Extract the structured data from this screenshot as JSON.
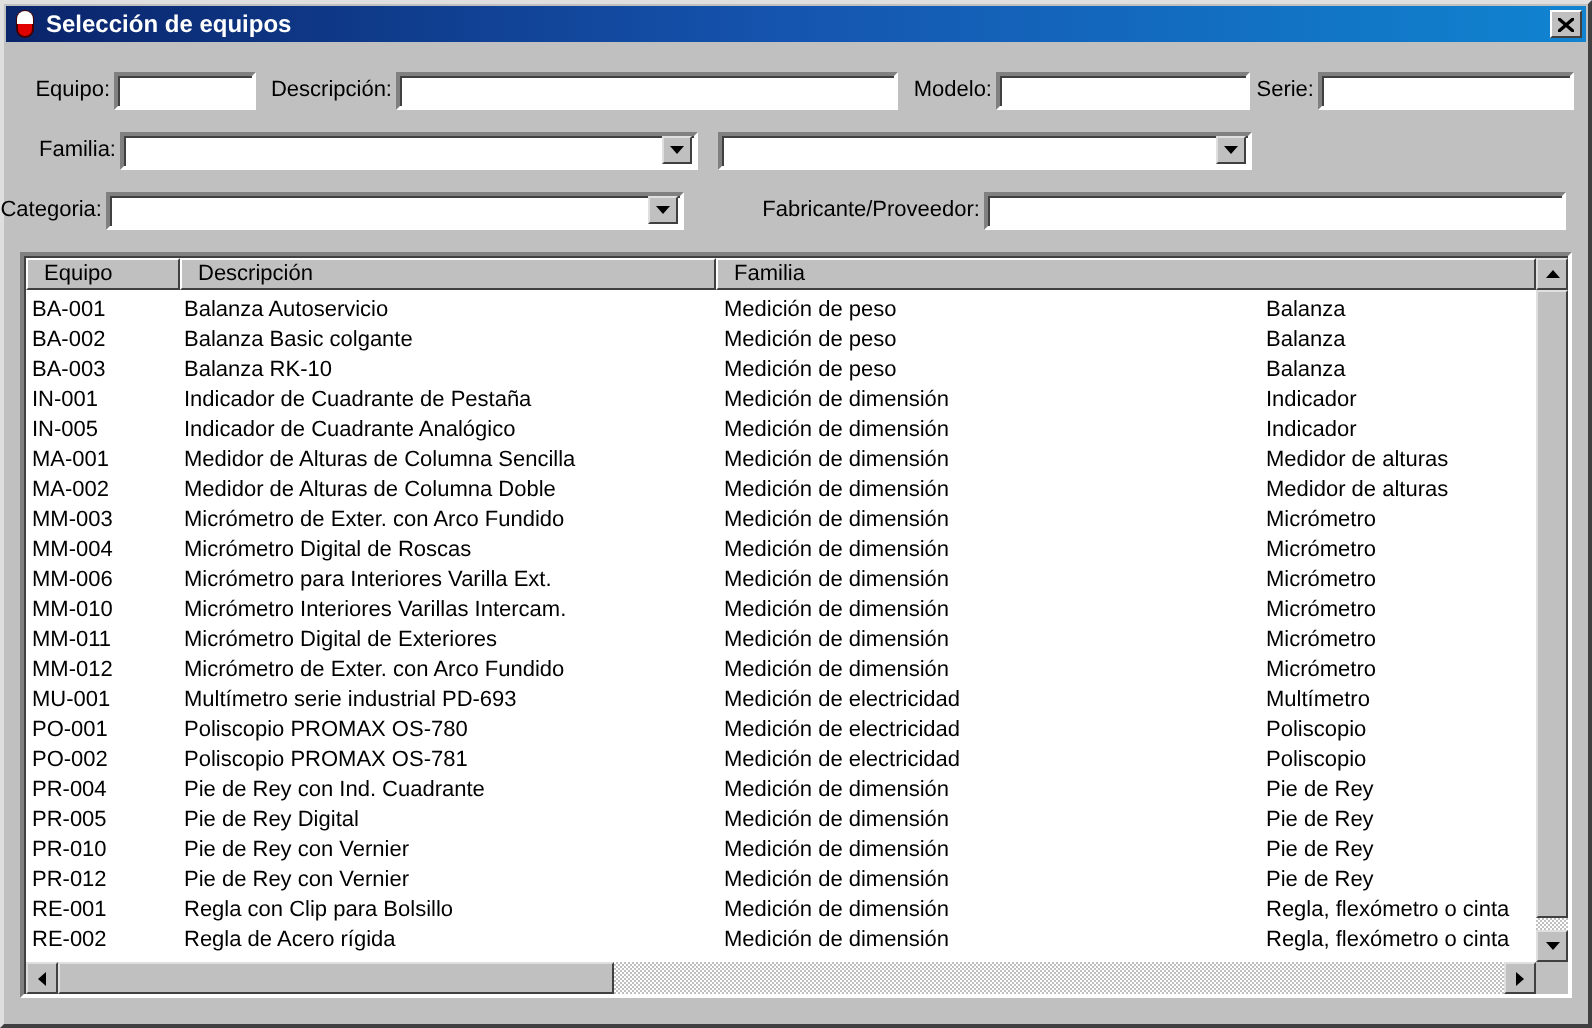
{
  "window": {
    "title": "Selección de equipos"
  },
  "form_rows": [
    {
      "fields": [
        {
          "kind": "text",
          "label": "Equipo:"
        },
        {
          "kind": "text",
          "label": "Descripción:"
        },
        {
          "kind": "text",
          "label": "Modelo:"
        },
        {
          "kind": "text",
          "label": "Serie:"
        }
      ]
    },
    {
      "fields": [
        {
          "kind": "dropdown",
          "label": "Familia:"
        },
        {
          "kind": "dropdown"
        }
      ]
    },
    {
      "fields": [
        {
          "kind": "dropdown",
          "label": "Categoria:"
        },
        {
          "kind": "text",
          "label": "Fabricante/Proveedor:"
        }
      ]
    }
  ],
  "table": {
    "columns": [
      "Equipo",
      "Descripción",
      "Familia"
    ],
    "rows": [
      {
        "cells": [
          "BA-001",
          "Balanza Autoservicio",
          "Medición de peso",
          "Balanza"
        ]
      },
      {
        "cells": [
          "BA-002",
          "Balanza Basic colgante",
          "Medición de peso",
          "Balanza"
        ]
      },
      {
        "cells": [
          "BA-003",
          "Balanza RK-10",
          "Medición de peso",
          "Balanza"
        ]
      },
      {
        "cells": [
          "IN-001",
          "Indicador de Cuadrante de Pestaña",
          "Medición de dimensión",
          "Indicador"
        ]
      },
      {
        "cells": [
          "IN-005",
          "Indicador de Cuadrante Analógico",
          "Medición de dimensión",
          "Indicador"
        ]
      },
      {
        "cells": [
          "MA-001",
          "Medidor de Alturas de Columna Sencilla",
          "Medición de dimensión",
          "Medidor de alturas"
        ]
      },
      {
        "cells": [
          "MA-002",
          "Medidor de Alturas de Columna Doble",
          "Medición de dimensión",
          "Medidor de alturas"
        ]
      },
      {
        "cells": [
          "MM-003",
          "Micrómetro de Exter. con Arco Fundido",
          "Medición de dimensión",
          "Micrómetro"
        ]
      },
      {
        "cells": [
          "MM-004",
          "Micrómetro Digital de Roscas",
          "Medición de dimensión",
          "Micrómetro"
        ]
      },
      {
        "cells": [
          "MM-006",
          "Micrómetro para Interiores Varilla Ext.",
          "Medición de dimensión",
          "Micrómetro"
        ]
      },
      {
        "cells": [
          "MM-010",
          "Micrómetro Interiores Varillas Intercam.",
          "Medición de dimensión",
          "Micrómetro"
        ]
      },
      {
        "cells": [
          "MM-011",
          "Micrómetro Digital de Exteriores",
          "Medición de dimensión",
          "Micrómetro"
        ]
      },
      {
        "cells": [
          "MM-012",
          "Micrómetro de Exter. con Arco Fundido",
          "Medición de dimensión",
          "Micrómetro"
        ]
      },
      {
        "cells": [
          "MU-001",
          "Multímetro serie industrial PD-693",
          "Medición de electricidad",
          "Multímetro"
        ]
      },
      {
        "cells": [
          "PO-001",
          "Poliscopio PROMAX OS-780",
          "Medición de electricidad",
          "Poliscopio"
        ]
      },
      {
        "cells": [
          "PO-002",
          "Poliscopio PROMAX OS-781",
          "Medición de electricidad",
          "Poliscopio"
        ]
      },
      {
        "cells": [
          "PR-004",
          "Pie de Rey con Ind. Cuadrante",
          "Medición de dimensión",
          "Pie de Rey"
        ]
      },
      {
        "cells": [
          "PR-005",
          "Pie de Rey Digital",
          "Medición de dimensión",
          "Pie de Rey"
        ]
      },
      {
        "cells": [
          "PR-010",
          "Pie de Rey con Vernier",
          "Medición de dimensión",
          "Pie de Rey"
        ]
      },
      {
        "cells": [
          "PR-012",
          "Pie de Rey con Vernier",
          "Medición de dimensión",
          "Pie de Rey"
        ]
      },
      {
        "cells": [
          "RE-001",
          "Regla con Clip para Bolsillo",
          "Medición de dimensión",
          "Regla, flexómetro o cinta"
        ]
      },
      {
        "cells": [
          "RE-002",
          "Regla de Acero rígida",
          "Medición de dimensión",
          "Regla, flexómetro o cinta"
        ]
      }
    ]
  }
}
